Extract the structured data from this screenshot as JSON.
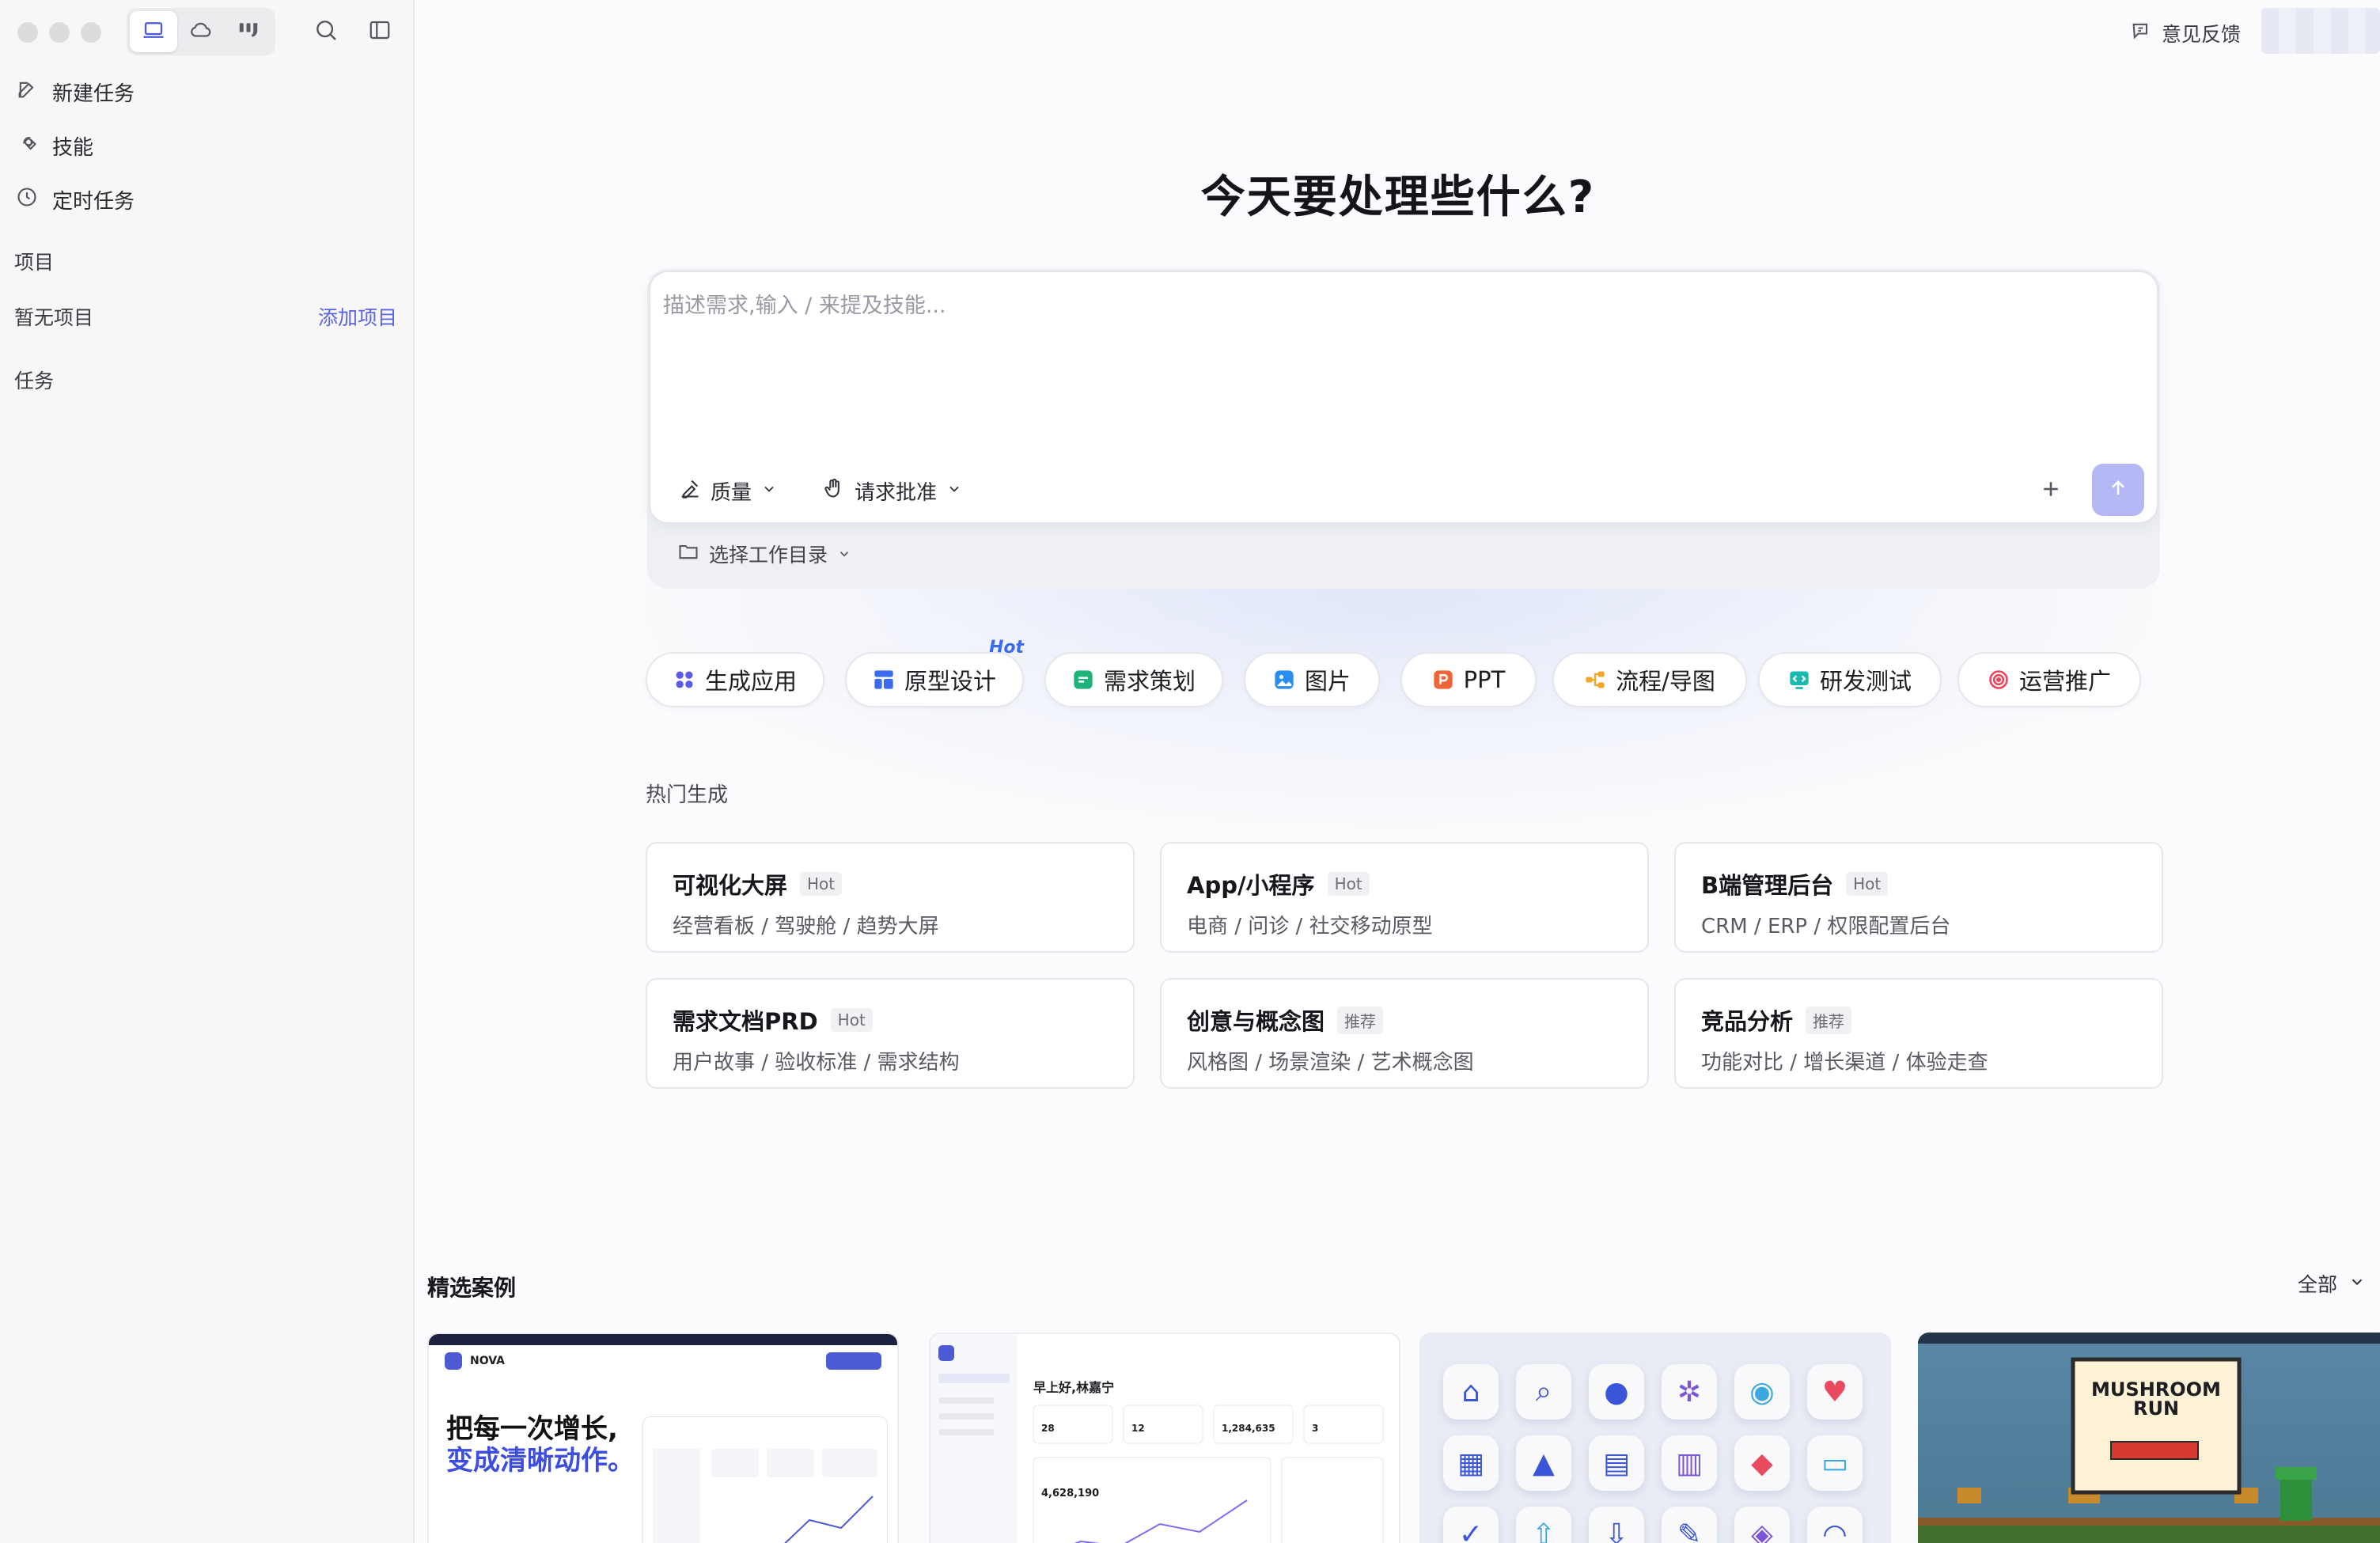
{
  "sidebar": {
    "nav": [
      {
        "label": "新建任务",
        "icon": "edit-icon"
      },
      {
        "label": "技能",
        "icon": "tools-icon"
      },
      {
        "label": "定时任务",
        "icon": "clock-icon"
      }
    ],
    "projects_label": "项目",
    "no_projects": "暂无项目",
    "add_project": "添加项目",
    "tasks_label": "任务"
  },
  "header": {
    "feedback_label": "意见反馈"
  },
  "main": {
    "title": "今天要处理些什么?",
    "composer": {
      "placeholder": "描述需求,输入 / 来提及技能...",
      "quality_label": "质量",
      "approval_label": "请求批准",
      "workdir_label": "选择工作目录"
    },
    "chips": [
      {
        "label": "生成应用",
        "color": "#5b5ce8"
      },
      {
        "label": "原型设计",
        "color": "#3b6bf0"
      },
      {
        "label": "需求策划",
        "color": "#1fb37a"
      },
      {
        "label": "图片",
        "color": "#2a8ef0"
      },
      {
        "label": "PPT",
        "color": "#f0643a"
      },
      {
        "label": "流程/导图",
        "color": "#f5a524"
      },
      {
        "label": "研发测试",
        "color": "#19b9b0"
      },
      {
        "label": "运营推广",
        "color": "#f0445a"
      }
    ],
    "chip_hot_tag": "Hot",
    "hot_heading": "热门生成",
    "hot_cards": [
      {
        "title": "可视化大屏",
        "badge": "Hot",
        "sub": "经营看板 / 驾驶舱 / 趋势大屏"
      },
      {
        "title": "App/小程序",
        "badge": "Hot",
        "sub": "电商 / 问诊 / 社交移动原型"
      },
      {
        "title": "B端管理后台",
        "badge": "Hot",
        "sub": "CRM / ERP / 权限配置后台"
      },
      {
        "title": "需求文档PRD",
        "badge": "Hot",
        "sub": "用户故事 / 验收标准 / 需求结构"
      },
      {
        "title": "创意与概念图",
        "badge": "推荐",
        "sub": "风格图 / 场景渲染 / 艺术概念图"
      },
      {
        "title": "竞品分析",
        "badge": "推荐",
        "sub": "功能对比 / 增长渠道 / 体验走查"
      }
    ],
    "featured_heading": "精选案例",
    "featured_filter": "全部",
    "cases": {
      "case1": {
        "brand": "NOVA",
        "headline_1": "把每一次增长,",
        "headline_2": "变成清晰动作。"
      },
      "case2": {
        "greeting": "早上好,林嘉宁",
        "stat_1": "28",
        "stat_2": "12",
        "stat_3": "1,284,635",
        "stat_4": "3",
        "big_value": "4,628,190"
      },
      "case4": {
        "title_1": "MUSHROOM",
        "title_2": "RUN"
      }
    }
  }
}
